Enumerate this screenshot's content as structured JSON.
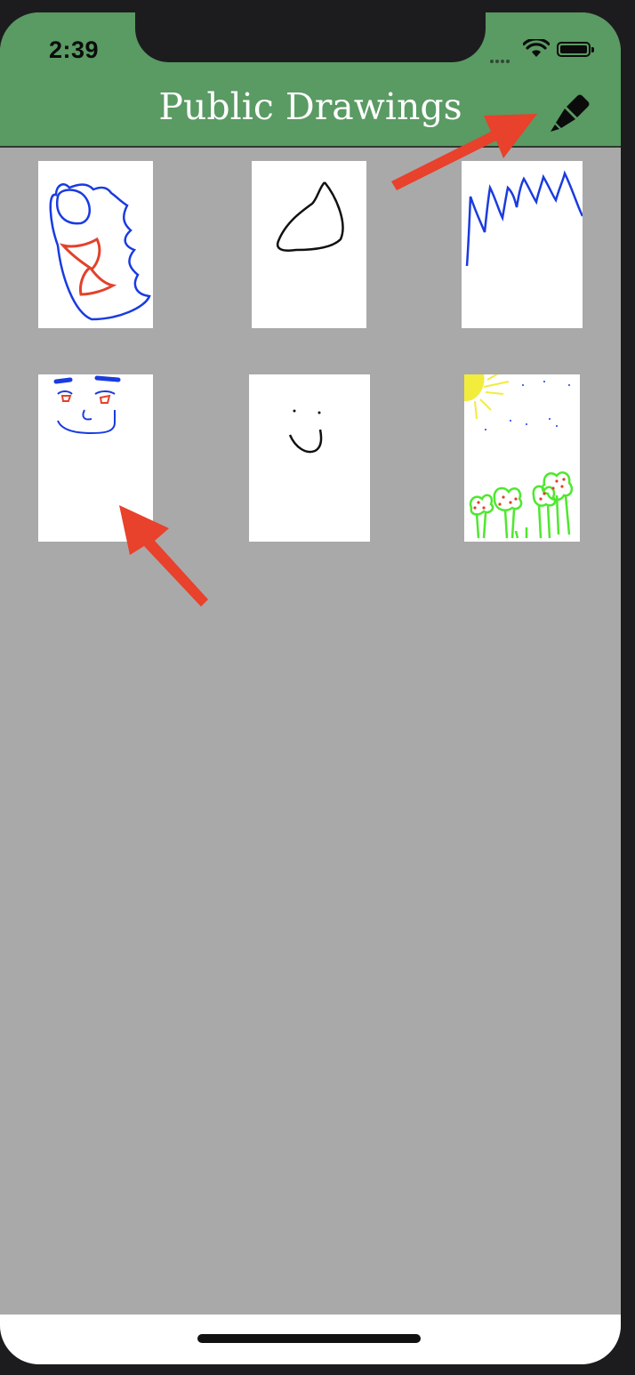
{
  "status_bar": {
    "time": "2:39"
  },
  "nav": {
    "title": "Public Drawings",
    "compose_icon": "pencil-icon"
  },
  "drawings": [
    {
      "label": "drawing-1",
      "subject": "blue and red scribble face"
    },
    {
      "label": "drawing-2",
      "subject": "black loop"
    },
    {
      "label": "drawing-3",
      "subject": "blue zigzag"
    },
    {
      "label": "drawing-4",
      "subject": "blue face with red eyes"
    },
    {
      "label": "drawing-5",
      "subject": "black smiley"
    },
    {
      "label": "drawing-6",
      "subject": "sun and green flowers"
    }
  ],
  "colors": {
    "header": "#5a9a63",
    "background": "#a9a9a9",
    "annotation_arrow": "#e8412c"
  }
}
